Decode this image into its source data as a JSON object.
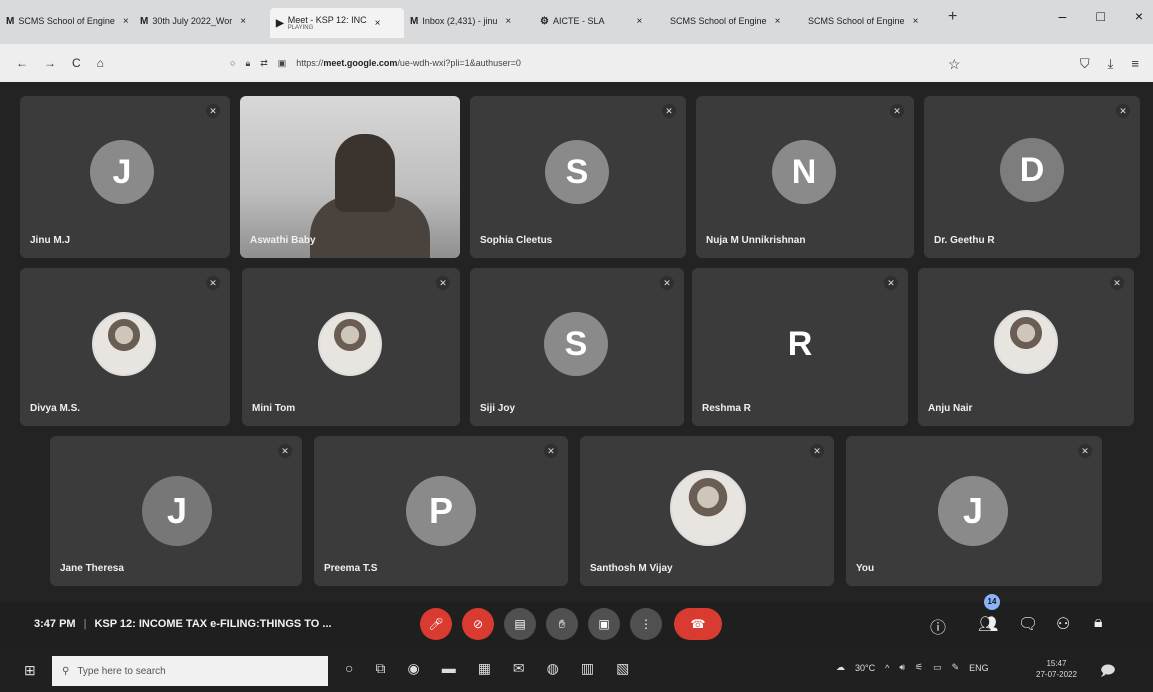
{
  "browser": {
    "tabs": [
      {
        "icon": "M",
        "label": "SCMS School of Engine",
        "close": "×"
      },
      {
        "icon": "M",
        "label": "30th July 2022_Wor",
        "close": "×"
      },
      {
        "icon": "▶",
        "label": "Meet - KSP 12: INC",
        "sub": "PLAYING",
        "close": "×",
        "active": true
      },
      {
        "icon": "M",
        "label": "Inbox (2,431) - jinu",
        "close": "×"
      },
      {
        "icon": "⚙",
        "label": "AICTE - SLA",
        "close": "×"
      },
      {
        "icon": "",
        "label": "SCMS School of Engine",
        "close": "×"
      },
      {
        "icon": "",
        "label": "SCMS School of Engine",
        "close": "×"
      }
    ],
    "new_tab": "+",
    "window_controls": {
      "minimize": "–",
      "maximize": "□",
      "close": "×"
    },
    "nav": {
      "back": "←",
      "forward": "→",
      "reload": "C",
      "home": "⌂"
    },
    "url_prefix": "https://",
    "url_host": "meet.google.com",
    "url_rest": "/ue-wdh-wxi?pli=1&authuser=0",
    "bookmark_star": "☆",
    "right_icons": [
      "shield-icon",
      "download-icon",
      "extensions-icon"
    ]
  },
  "meet": {
    "participants": [
      {
        "name": "Jinu M.J",
        "initial": "J",
        "kind": "initial",
        "muted": true
      },
      {
        "name": "Aswathi Baby",
        "initial": "",
        "kind": "video",
        "muted": false
      },
      {
        "name": "Sophia Cleetus",
        "initial": "S",
        "kind": "initial",
        "muted": true
      },
      {
        "name": "Nuja M Unnikrishnan",
        "initial": "N",
        "kind": "initial",
        "muted": true
      },
      {
        "name": "Dr. Geethu R",
        "initial": "D",
        "kind": "initial",
        "muted": true
      },
      {
        "name": "Divya M.S.",
        "initial": "",
        "kind": "photo",
        "muted": true
      },
      {
        "name": "Mini Tom",
        "initial": "",
        "kind": "photo",
        "muted": true
      },
      {
        "name": "Siji Joy",
        "initial": "S",
        "kind": "initial",
        "muted": true
      },
      {
        "name": "Reshma R",
        "initial": "R",
        "kind": "plain",
        "muted": true
      },
      {
        "name": "Anju Nair",
        "initial": "",
        "kind": "photo",
        "muted": true
      },
      {
        "name": "Jane Theresa",
        "initial": "J",
        "kind": "initial",
        "muted": true
      },
      {
        "name": "Preema T.S",
        "initial": "P",
        "kind": "initial",
        "muted": true
      },
      {
        "name": "Santhosh M Vijay",
        "initial": "",
        "kind": "photo",
        "muted": true
      },
      {
        "name": "You",
        "initial": "J",
        "kind": "initial",
        "muted": true
      }
    ],
    "time": "3:47 PM",
    "separator": "|",
    "meeting_title": "KSP 12: INCOME TAX e-FILING:THINGS TO ...",
    "controls": [
      "mic-off",
      "camera-off",
      "captions",
      "raise-hand",
      "present",
      "more",
      "leave-call"
    ],
    "participant_count": "14",
    "right_controls": [
      "info",
      "people",
      "chat",
      "activities",
      "host-controls"
    ]
  },
  "taskbar": {
    "search_placeholder": "Type here to search",
    "temperature": "30°C",
    "language": "ENG",
    "clock_time": "15:47",
    "clock_date": "27-07-2022"
  },
  "colors": {
    "stage_bg": "#232323",
    "tile_bg": "#3b3b3b",
    "avatar_bg": "#8a8a8a",
    "leave_red": "#d93b30"
  }
}
